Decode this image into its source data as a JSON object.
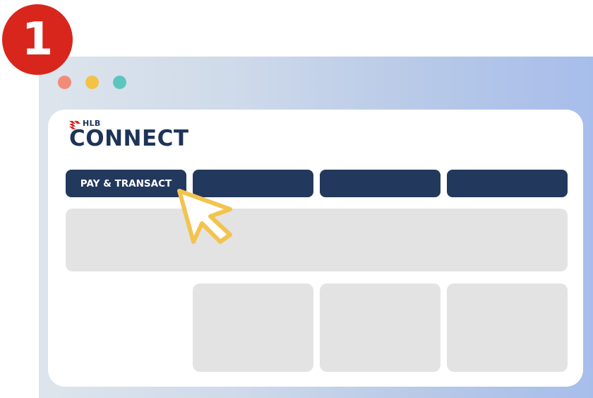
{
  "step": {
    "number": "1"
  },
  "window": {
    "controls": [
      "close",
      "minimize",
      "maximize"
    ]
  },
  "brand": {
    "small_label": "HLB",
    "wordmark": "CONNECT",
    "mark_icon": "hlb-logo-mark-icon"
  },
  "nav": {
    "tabs": [
      {
        "label": "PAY & TRANSACT"
      },
      {
        "label": ""
      },
      {
        "label": ""
      },
      {
        "label": ""
      }
    ]
  },
  "cursor": {
    "icon": "pointer-hand-icon"
  },
  "colors": {
    "badge": "#d8261c",
    "nav_tab": "#22385d",
    "placeholder": "#e3e3e3",
    "cursor_outline": "#f2c44f",
    "logo_red": "#d8261c",
    "logo_navy": "#1d3458"
  }
}
